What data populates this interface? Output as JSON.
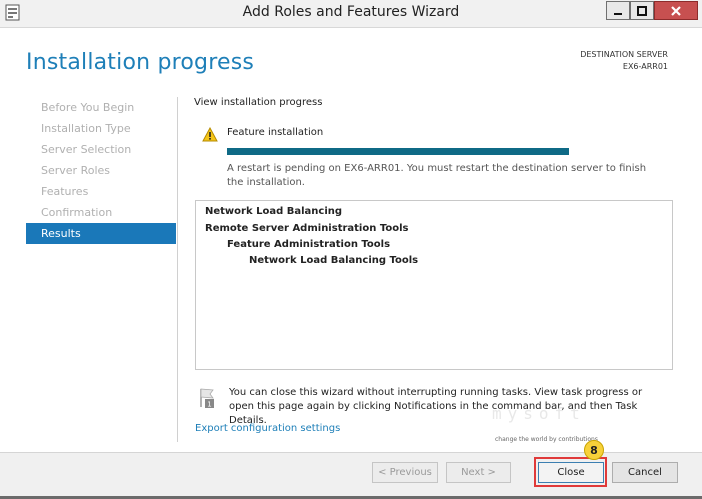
{
  "window": {
    "title": "Add Roles and Features Wizard",
    "controls": [
      "minimize-icon",
      "maximize-icon",
      "close-icon"
    ]
  },
  "header": {
    "page_title": "Installation progress",
    "destination_label": "DESTINATION SERVER",
    "destination_name": "EX6-ARR01"
  },
  "nav": {
    "items": [
      {
        "label": "Before You Begin",
        "active": false
      },
      {
        "label": "Installation Type",
        "active": false
      },
      {
        "label": "Server Selection",
        "active": false
      },
      {
        "label": "Server Roles",
        "active": false
      },
      {
        "label": "Features",
        "active": false
      },
      {
        "label": "Confirmation",
        "active": false
      },
      {
        "label": "Results",
        "active": true
      }
    ]
  },
  "main": {
    "section_label": "View installation progress",
    "feature_label": "Feature installation",
    "progress_fraction": 1.0,
    "restart_message": "A restart is pending on EX6-ARR01. You must restart the destination server to finish the installation.",
    "results": [
      "Network Load Balancing",
      "Remote Server Administration Tools",
      "Feature Administration Tools",
      "Network Load Balancing Tools"
    ],
    "note": "You can close this wizard without interrupting running tasks. View task progress or open this page again by clicking Notifications in the command bar, and then Task Details.",
    "export_link": "Export configuration settings"
  },
  "footer": {
    "previous_label": "< Previous",
    "next_label": "Next >",
    "close_label": "Close",
    "cancel_label": "Cancel",
    "step_badge": "8"
  },
  "watermark": {
    "text": "mysoft",
    "tagline": "change the world by contributions"
  },
  "colors": {
    "accent": "#1e7fb8",
    "nav_active": "#1a78b9",
    "progress": "#0f6a86",
    "highlight": "#e03a3a",
    "badge": "#f7d13a"
  }
}
